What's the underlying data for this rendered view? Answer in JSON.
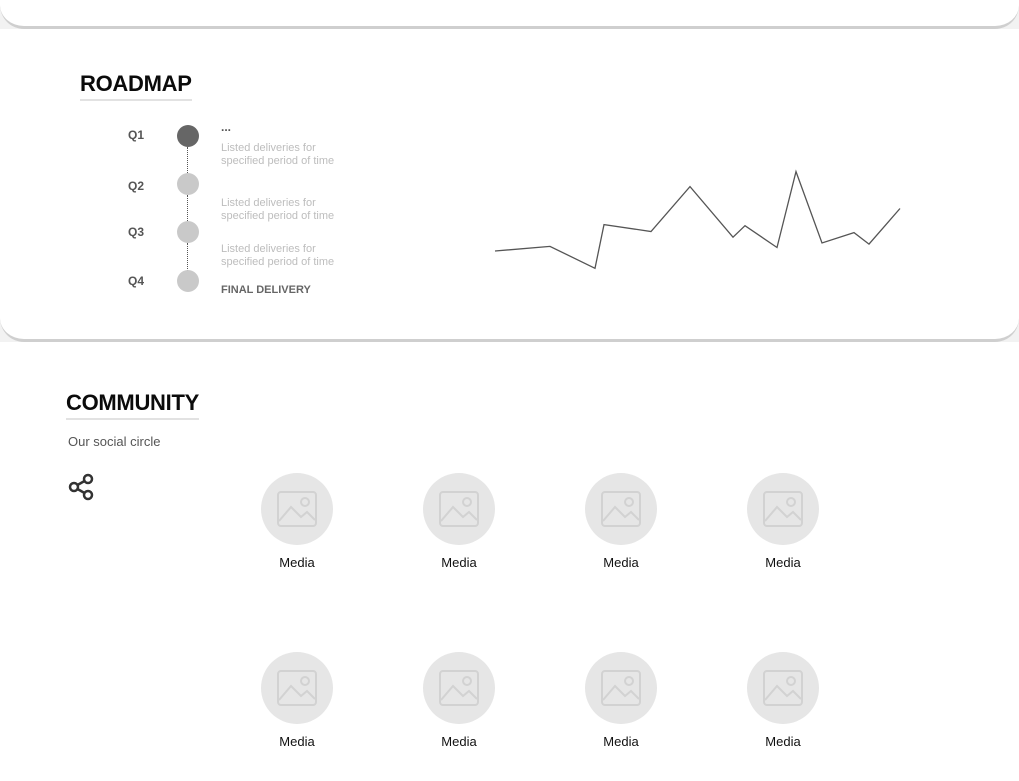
{
  "roadmap": {
    "title": "ROADMAP",
    "quarters": [
      {
        "label": "Q1",
        "active": true
      },
      {
        "label": "Q2",
        "active": false
      },
      {
        "label": "Q3",
        "active": false
      },
      {
        "label": "Q4",
        "active": false
      }
    ],
    "ellipsis": "...",
    "descriptions": [
      "Listed deliveries for specified period of time",
      "Listed deliveries for specified period of time",
      "Listed deliveries for specified period of time"
    ],
    "final_label": "FINAL DELIVERY"
  },
  "chart_data": {
    "type": "line",
    "title": "",
    "xlabel": "",
    "ylabel": "",
    "x": [
      0,
      1,
      2,
      3,
      4,
      5,
      6,
      7,
      8,
      9,
      10,
      11,
      12,
      13,
      14
    ],
    "series": [
      {
        "values": [
          20,
          24,
          5,
          43,
          37,
          76,
          32,
          42,
          23,
          89,
          27,
          36,
          26,
          57,
          57
        ]
      }
    ],
    "ylim": [
      0,
      100
    ],
    "grid": false,
    "line_color": "#555555"
  },
  "community": {
    "title": "COMMUNITY",
    "subtitle": "Our social circle",
    "share_icon": "share-icon",
    "media": [
      {
        "label": "Media"
      },
      {
        "label": "Media"
      },
      {
        "label": "Media"
      },
      {
        "label": "Media"
      },
      {
        "label": "Media"
      },
      {
        "label": "Media"
      },
      {
        "label": "Media"
      },
      {
        "label": "Media"
      }
    ]
  }
}
